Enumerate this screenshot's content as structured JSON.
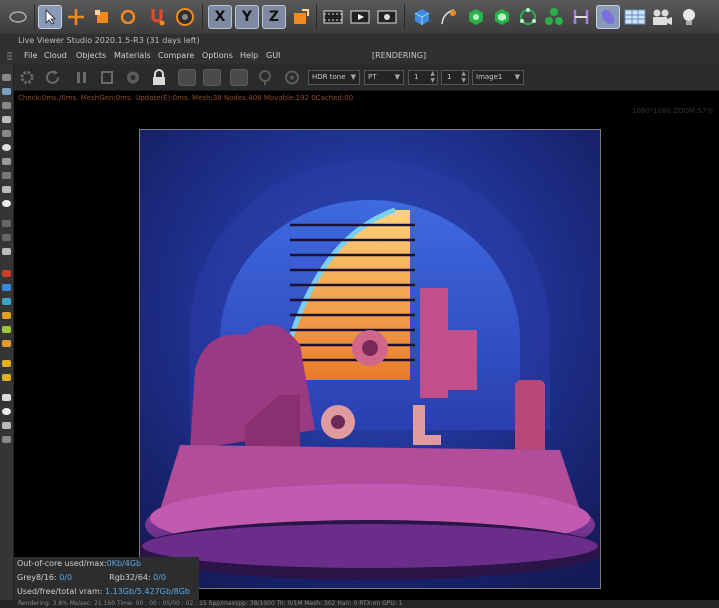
{
  "app": {
    "window_title": "Live Viewer Studio 2020.1.5-R3 (31 days left)",
    "status_label": "[RENDERING]"
  },
  "menu": [
    "File",
    "Cloud",
    "Objects",
    "Materials",
    "Compare",
    "Options",
    "Help",
    "GUI"
  ],
  "render_toolbar": {
    "tone_mode": "HDR tone",
    "kernel": "PT",
    "value_a": "1",
    "value_b": "1",
    "pass": "Image1"
  },
  "viewport": {
    "stats_line": "Check:0ms./0ms. MeshGen:0ms. Update(E):0ms. Mesh:38 Nodes:406 Movable:192 0Cached:00",
    "resolution": "1080*1080 ZOOM:57%"
  },
  "info": {
    "ooc_label": "Out-of-core used/max:",
    "ooc_value": "0Kb/4Gb",
    "grey_label": "Grey8/16:",
    "grey_value": "0/0",
    "rgb_label": "Rgb32/64:",
    "rgb_value": "0/0",
    "vram_label": "Used/free/total vram:",
    "vram_value": "1.13Gb/5.427Gb/8Gb"
  },
  "status_bar": "Rendering: 3.8%  Ms/sec: 21.160  Time: 00 : 00 : 05/00 : 02 : 15  Spp/maxspp: 38/1000  Tri: 0/1M  Mesh: 302  Hair: 0  RTX:on  GPU: 1",
  "colors": {
    "accent_selected": "#8a9ab6",
    "stats_text": "#8c4a2c",
    "info_highlight": "#59a9e8",
    "scene_background": "#1a2570",
    "scene_pink": "#b0477e"
  },
  "toolbar_icons": [
    "select-arrow-icon",
    "move-icon",
    "scale-icon",
    "rotate-icon",
    "snap-icon",
    "target-icon",
    "axis-x-icon",
    "axis-y-icon",
    "axis-z-icon",
    "coordinate-system-icon",
    "render-region-icon",
    "render-view-icon",
    "render-settings-icon",
    "cube-icon",
    "spline-pen-icon",
    "generator-icon",
    "subdivision-icon",
    "cloner-icon",
    "mograph-icon",
    "deformer-icon",
    "field-icon",
    "floor-icon",
    "camera-icon",
    "light-icon"
  ]
}
